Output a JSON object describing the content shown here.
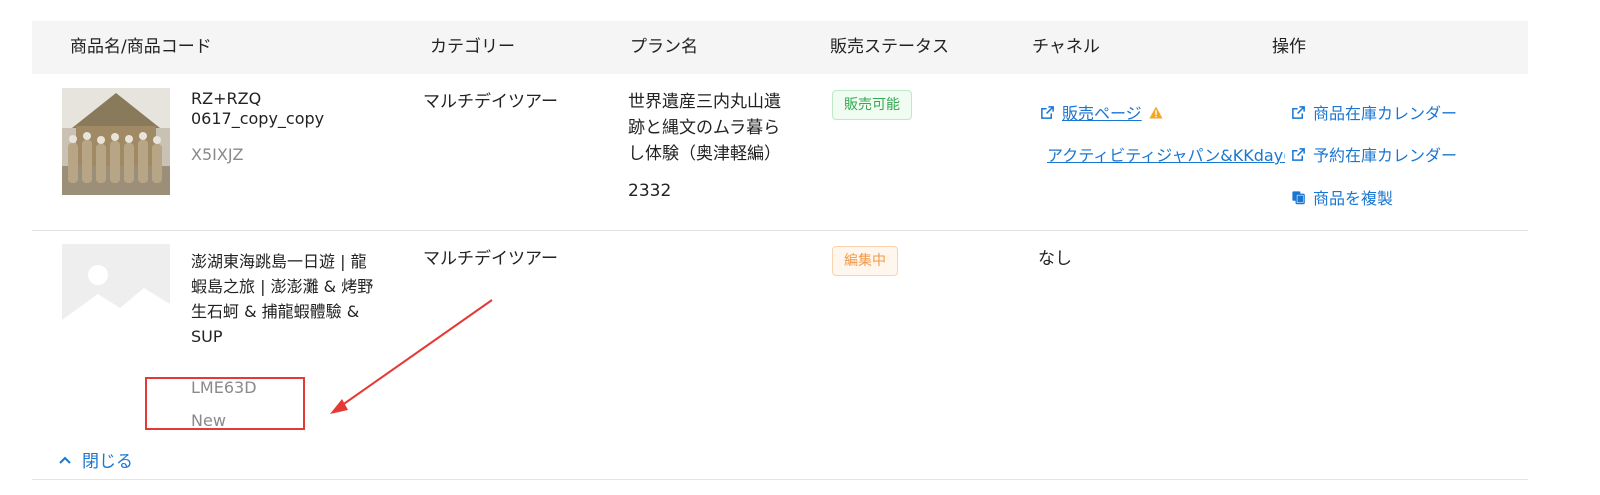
{
  "headers": {
    "product": "商品名/商品コード",
    "category": "カテゴリー",
    "plan": "プラン名",
    "status": "販売ステータス",
    "channel": "チャネル",
    "actions": "操作"
  },
  "rows": [
    {
      "name_lines": [
        "RZ+RZQ",
        "0617_copy_copy"
      ],
      "code": "X5IXJZ",
      "category": "マルチデイツアー",
      "plan_lines": [
        "世界遺産三内丸山遺",
        "跡と縄文のムラ暮ら",
        "し体験（奥津軽編）"
      ],
      "plan_code": "2332",
      "status": "販売可能",
      "channels": [
        "販売ページ",
        "アクティビティジャパン&KKday(一般)"
      ],
      "actions": [
        "商品在庫カレンダー",
        "予約在庫カレンダー",
        "商品を複製"
      ]
    },
    {
      "name_lines": [
        "澎湖東海跳島一日遊 | 龍",
        "蝦島之旅 | 澎澎灘 & 烤野",
        "生石蚵 & 捕龍蝦體驗 &",
        "SUP"
      ],
      "code": "LME63D",
      "tag": "New",
      "category": "マルチデイツアー",
      "status": "編集中",
      "channel_text": "なし"
    }
  ],
  "collapse_label": "閉じる",
  "colors": {
    "link": "#1976d2",
    "badge_green": "#34a853",
    "badge_orange": "#f2994a",
    "annotation_red": "#e53935",
    "header_bg": "#f5f5f5"
  }
}
